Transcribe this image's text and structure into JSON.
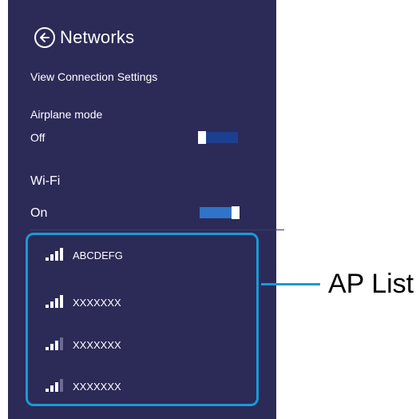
{
  "header": {
    "title": "Networks",
    "back_icon": "back-arrow-circle-icon"
  },
  "view_connection_settings": "View Connection Settings",
  "airplane_mode": {
    "label": "Airplane mode",
    "state_label": "Off",
    "on": false
  },
  "wifi": {
    "label": "Wi-Fi",
    "state_label": "On",
    "on": true
  },
  "ap_list": {
    "items": [
      {
        "name": "ABCDEFG",
        "signal_bars": 4,
        "signal_icon": "wifi-signal-icon"
      },
      {
        "name": "XXXXXXX",
        "signal_bars": 4,
        "signal_icon": "wifi-signal-icon"
      },
      {
        "name": "XXXXXXX",
        "signal_bars": 3,
        "signal_icon": "wifi-signal-icon"
      },
      {
        "name": "XXXXXXX",
        "signal_bars": 3,
        "signal_icon": "wifi-signal-icon"
      }
    ]
  },
  "callout": {
    "label": "AP List"
  },
  "colors": {
    "panel_bg": "#2c2a57",
    "accent": "#1a9ad6",
    "toggle_off_track": "#1d3f8f",
    "toggle_on_track": "#2f74c8",
    "text": "#ffffff"
  }
}
